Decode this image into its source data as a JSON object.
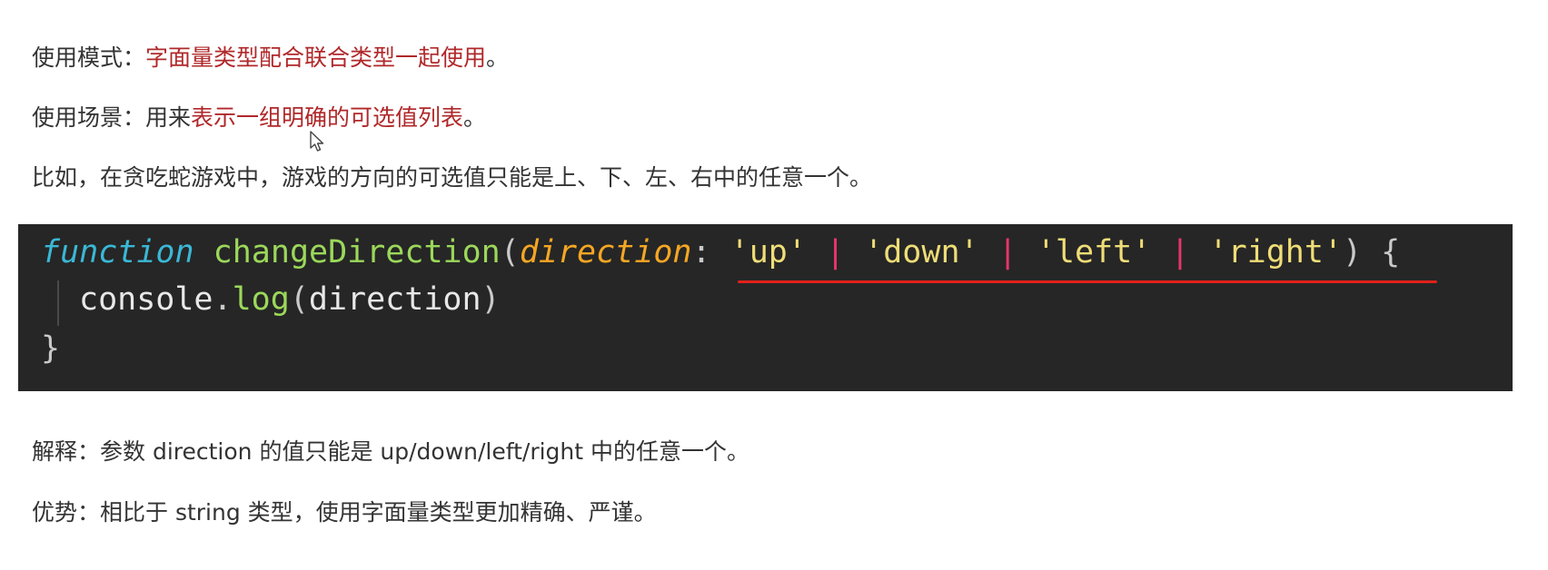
{
  "intro": {
    "mode": {
      "label": "使用模式：",
      "highlight": "字面量类型配合联合类型一起使用",
      "end": "。"
    },
    "scene": {
      "label": "使用场景：用来",
      "highlight": "表示一组明确的可选值列表",
      "end": "。"
    },
    "example": "比如，在贪吃蛇游戏中，游戏的方向的可选值只能是上、下、左、右中的任意一个。"
  },
  "code": {
    "line1": {
      "keyword": "function",
      "name": "changeDirection",
      "open_paren": "(",
      "param": "direction",
      "colon": ":",
      "v1": "'up'",
      "pipe": "|",
      "v2": "'down'",
      "v3": "'left'",
      "v4": "'right'",
      "close": ")",
      "brace": "{"
    },
    "line2": {
      "object": "console",
      "dot": ".",
      "method": "log",
      "open": "(",
      "arg": "direction",
      "close": ")"
    },
    "line3": {
      "brace": "}"
    }
  },
  "notes": {
    "explain": "解释：参数 direction 的值只能是 up/down/left/right 中的任意一个。",
    "advantage": "优势：相比于 string 类型，使用字面量类型更加精确、严谨。"
  },
  "colors": {
    "highlight": "#b0282a",
    "code_bg": "#262626",
    "underline": "#e0201b"
  },
  "icons": {
    "cursor": "mouse-pointer-icon"
  }
}
